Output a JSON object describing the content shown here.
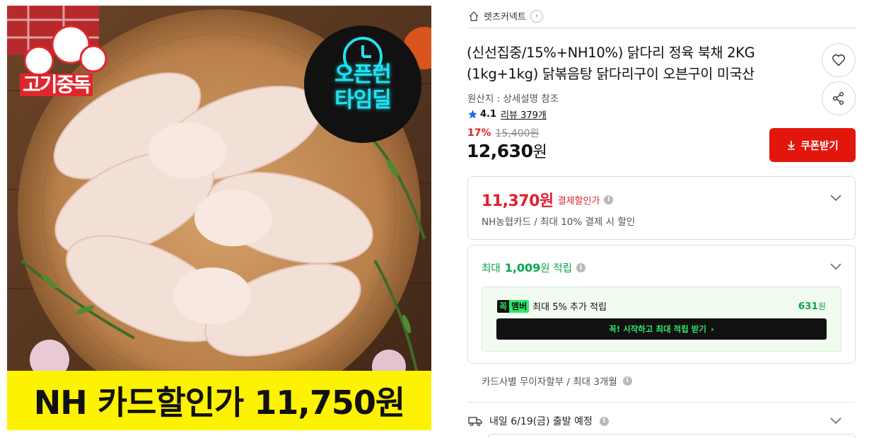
{
  "product_image": {
    "brand_logo_text": "고기중독",
    "timedeal_badge": [
      "오픈런",
      "타임딜"
    ],
    "banner_text": "NH 카드할인가 11,750원"
  },
  "store": {
    "name": "렛츠커넥트",
    "icon": "home-icon"
  },
  "product": {
    "title": "(신선집중/15%+NH10%) 닭다리 정육 북채 2KG (1kg+1kg) 닭볶음탕 닭다리구이 오븐구이 미국산",
    "origin": "원산지 : 상세설명 참조",
    "rating": "4.1",
    "review_link": "리뷰 379개",
    "discount_rate": "17%",
    "original_price": "15,400원",
    "sale_price_amount": "12,630",
    "sale_price_unit": "원"
  },
  "actions": {
    "coupon_label": "쿠폰받기",
    "wishlist_icon": "heart-icon",
    "share_icon": "share-icon"
  },
  "card_discount": {
    "amount": "11,370원",
    "label": "결제할인가",
    "description": "NH농협카드 / 최대 10% 결제 시 할인"
  },
  "points": {
    "prefix": "최대",
    "amount": "1,009",
    "suffix": "원 적립",
    "member_badge_a": "꼭",
    "member_badge_b": "멤버",
    "member_text": "최대 5% 추가 적립",
    "member_points_amount": "631",
    "member_points_unit": "원",
    "member_cta": "꼭! 시작하고 최대 적립 받기"
  },
  "installment": "카드사별 무이자할부 / 최대 3개월",
  "delivery": "내일 6/19(금) 출발 예정",
  "colors": {
    "accent_red": "#e3160e",
    "point_green": "#0ba34c",
    "member_green": "#2ee86e",
    "banner_yellow": "#fdf200"
  }
}
